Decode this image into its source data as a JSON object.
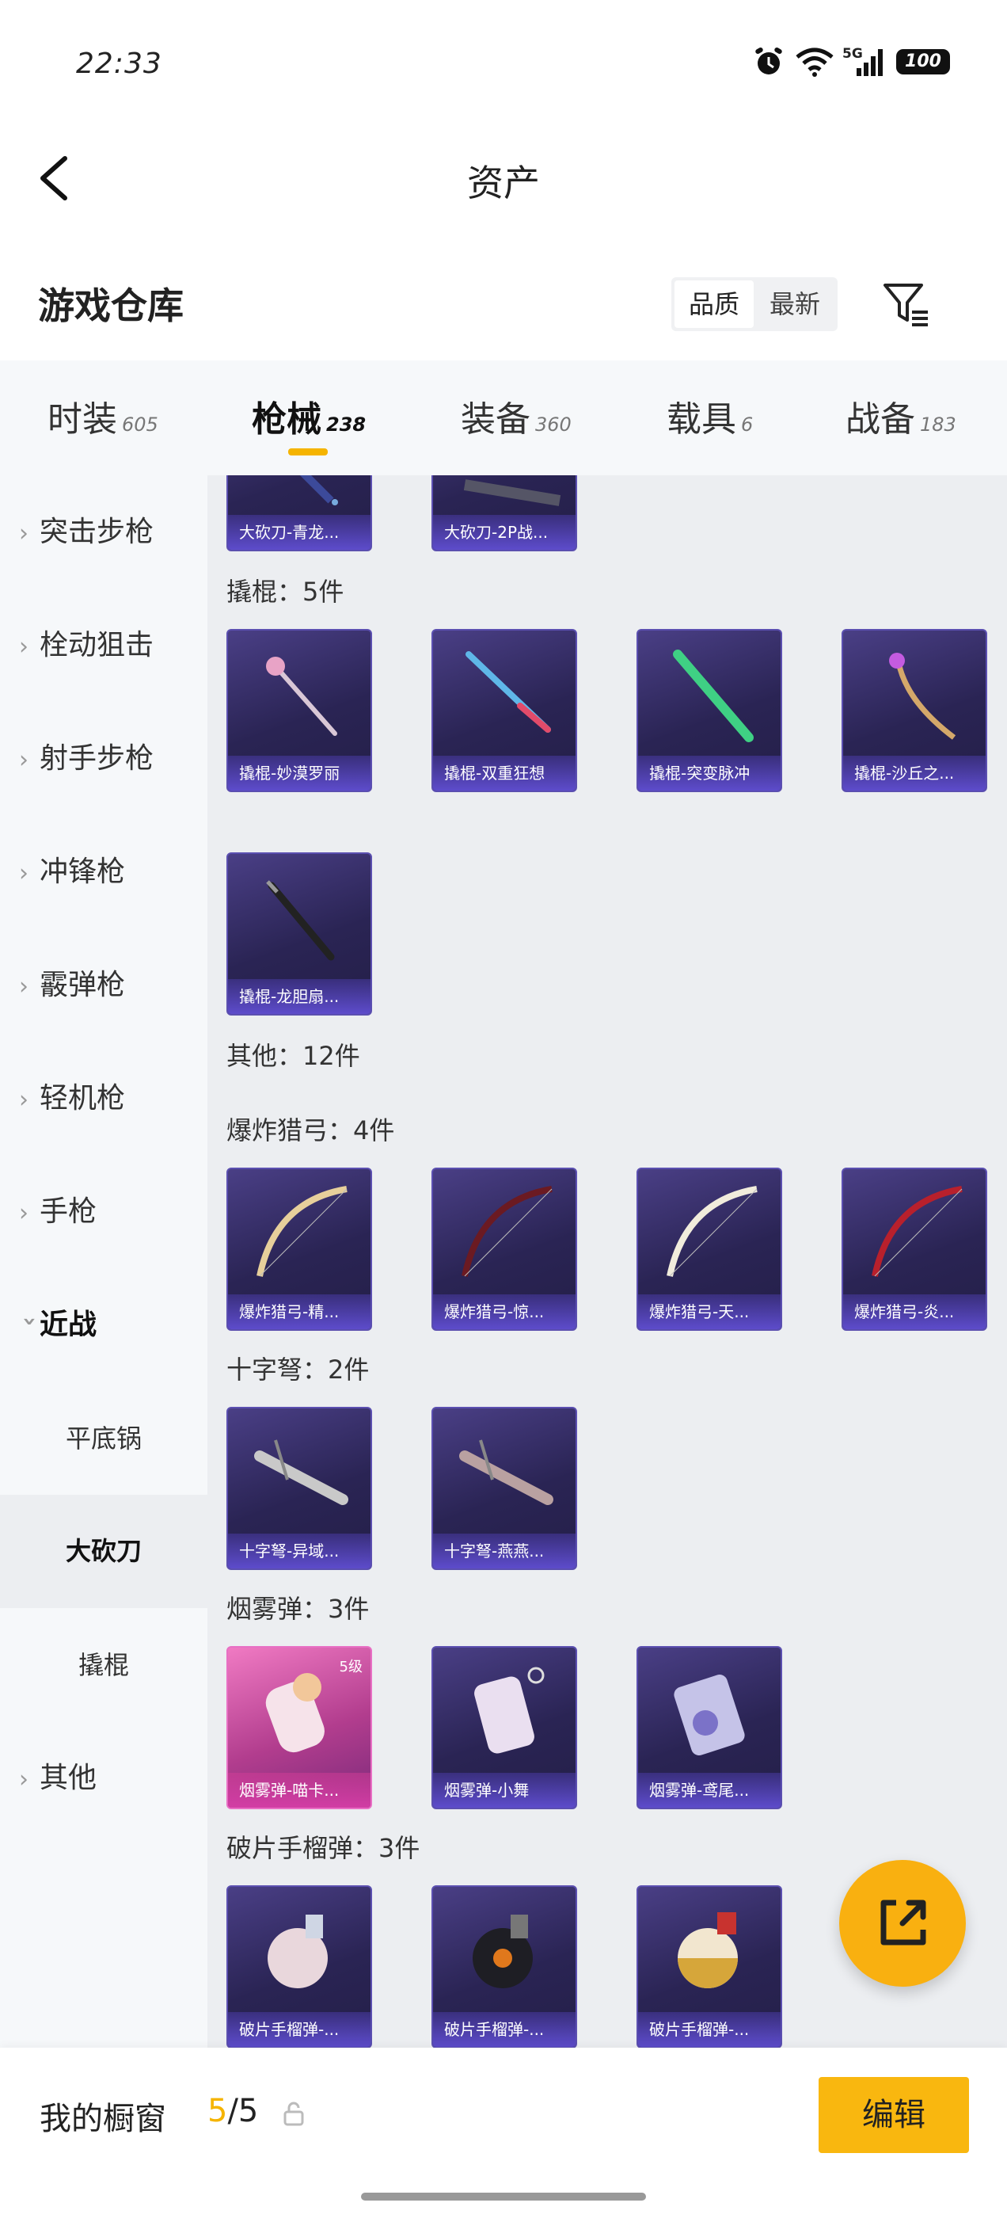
{
  "status_bar": {
    "time": "22:33",
    "network": "5G",
    "battery": "100"
  },
  "header": {
    "title": "资产"
  },
  "section": {
    "title": "游戏仓库",
    "sort_options": [
      "品质",
      "最新"
    ]
  },
  "tabs": [
    {
      "label": "时装",
      "count": "605"
    },
    {
      "label": "枪械",
      "count": "238",
      "active": true
    },
    {
      "label": "装备",
      "count": "360"
    },
    {
      "label": "载具",
      "count": "6"
    },
    {
      "label": "战备",
      "count": "183"
    }
  ],
  "sidebar": [
    {
      "label": "突击步枪"
    },
    {
      "label": "栓动狙击"
    },
    {
      "label": "射手步枪"
    },
    {
      "label": "冲锋枪"
    },
    {
      "label": "霰弹枪"
    },
    {
      "label": "轻机枪"
    },
    {
      "label": "手枪"
    },
    {
      "label": "近战",
      "expanded": true
    },
    {
      "label": "平底锅",
      "sub": true
    },
    {
      "label": "大砍刀",
      "sub": true,
      "selected": true
    },
    {
      "label": "撬棍",
      "sub": true
    },
    {
      "label": "其他"
    }
  ],
  "content": {
    "top_partial": [
      "大砍刀-青龙...",
      "大砍刀-2P战..."
    ],
    "groups": [
      {
        "label": "撬棍：5件",
        "items": [
          "撬棍-妙漠罗丽",
          "撬棍-双重狂想",
          "撬棍-突变脉冲",
          "撬棍-沙丘之...",
          "撬棍-龙胆扇..."
        ]
      },
      {
        "label": "其他：12件",
        "items": []
      },
      {
        "label": "爆炸猎弓：4件",
        "items": [
          "爆炸猎弓-精...",
          "爆炸猎弓-惊...",
          "爆炸猎弓-天...",
          "爆炸猎弓-炎..."
        ]
      },
      {
        "label": "十字弩：2件",
        "items": [
          "十字弩-异域...",
          "十字弩-燕燕..."
        ]
      },
      {
        "label": "烟雾弹：3件",
        "items": [
          "烟雾弹-喵卡...",
          "烟雾弹-小舞",
          "烟雾弹-鸢尾..."
        ],
        "first_badge": "5级"
      },
      {
        "label": "破片手榴弹：3件",
        "items": [
          "破片手榴弹-...",
          "破片手榴弹-...",
          "破片手榴弹-..."
        ]
      }
    ]
  },
  "bottom_bar": {
    "label": "我的橱窗",
    "count_current": "5",
    "count_total": "/5",
    "edit_label": "编辑"
  },
  "colors": {
    "accent": "#f9b70f",
    "card_dark": "#2a2454",
    "card_pink": "#d33ea6"
  }
}
